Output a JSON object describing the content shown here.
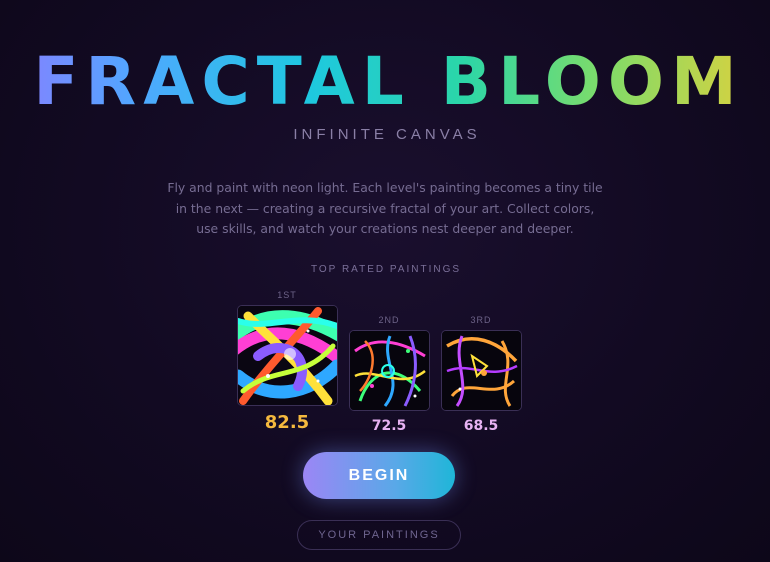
{
  "header": {
    "title": "FRACTAL BLOOM",
    "subtitle": "INFINITE CANVAS",
    "description": "Fly and paint with neon light. Each level's painting becomes a tiny tile in the next — creating a recursive fractal of your art. Collect colors, use skills, and watch your creations nest deeper and deeper."
  },
  "leaderboard": {
    "label": "TOP RATED PAINTINGS",
    "entries": [
      {
        "rank": "1ST",
        "score": "82.5",
        "score_color": "#f5b93e"
      },
      {
        "rank": "2ND",
        "score": "72.5",
        "score_color": "#e7b2f2"
      },
      {
        "rank": "3RD",
        "score": "68.5",
        "score_color": "#e7b2f2"
      }
    ]
  },
  "actions": {
    "begin_label": "BEGIN",
    "paintings_label": "YOUR PAINTINGS"
  },
  "colors": {
    "accent_start": "#9b86f5",
    "accent_end": "#1fb6d8",
    "first_place": "#f5b93e",
    "other_place": "#e7b2f2"
  }
}
